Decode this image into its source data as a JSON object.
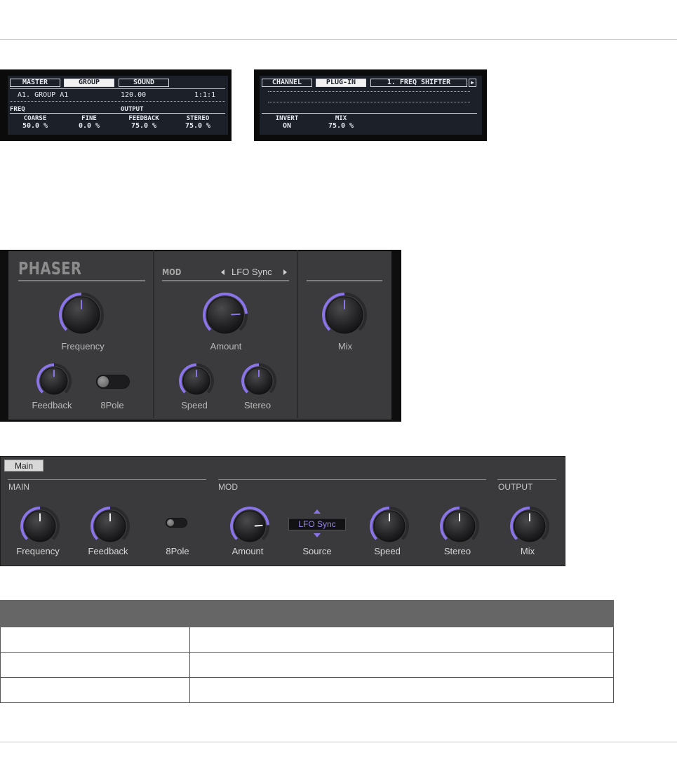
{
  "hardware_display": {
    "left": {
      "tabs": [
        "MASTER",
        "GROUP",
        "SOUND"
      ],
      "selected_tab": "GROUP",
      "group_name": "A1. GROUP A1",
      "tempo": "120.00",
      "position": "1:1:1",
      "sections": [
        "FREQ",
        "OUTPUT"
      ],
      "params": [
        {
          "label": "COARSE",
          "value": "50.0 %"
        },
        {
          "label": "FINE",
          "value": "0.0 %"
        },
        {
          "label": "FEEDBACK",
          "value": "75.0 %"
        },
        {
          "label": "STEREO",
          "value": "75.0 %"
        }
      ]
    },
    "right": {
      "tabs": [
        "CHANNEL",
        "PLUG-IN",
        "1. FREQ SHIFTER"
      ],
      "selected_tab": "PLUG-IN",
      "params": [
        {
          "label": "INVERT",
          "value": "ON"
        },
        {
          "label": "MIX",
          "value": "75.0 %"
        }
      ]
    }
  },
  "plugin": {
    "title": "PHASER",
    "mod_label": "MOD",
    "mod_source": "LFO Sync",
    "knobs": [
      {
        "label": "Frequency",
        "value": 0.5
      },
      {
        "label": "Amount",
        "value": 0.82
      },
      {
        "label": "Mix",
        "value": 0.5
      },
      {
        "label": "Feedback",
        "value": 0.5
      },
      {
        "label": "Speed",
        "value": 0.5
      },
      {
        "label": "Stereo",
        "value": 0.5
      }
    ],
    "toggle": {
      "label": "8Pole",
      "on": false
    }
  },
  "param_panel": {
    "tab": "Main",
    "sections": [
      "MAIN",
      "MOD",
      "OUTPUT"
    ],
    "controls": [
      {
        "label": "Frequency",
        "type": "knob",
        "value": 0.5
      },
      {
        "label": "Feedback",
        "type": "knob",
        "value": 0.5
      },
      {
        "label": "8Pole",
        "type": "toggle",
        "on": false
      },
      {
        "label": "Amount",
        "type": "knob",
        "value": 0.82
      },
      {
        "label": "Source",
        "type": "selector",
        "value": "LFO Sync"
      },
      {
        "label": "Speed",
        "type": "knob",
        "value": 0.5
      },
      {
        "label": "Stereo",
        "type": "knob",
        "value": 0.5
      },
      {
        "label": "Mix",
        "type": "knob",
        "value": 0.5
      }
    ]
  },
  "colors": {
    "accent": "#8a74e8",
    "lcd_bg": "#1c2029",
    "panel_bg": "#3a3a3c",
    "table_header": "#666666"
  }
}
